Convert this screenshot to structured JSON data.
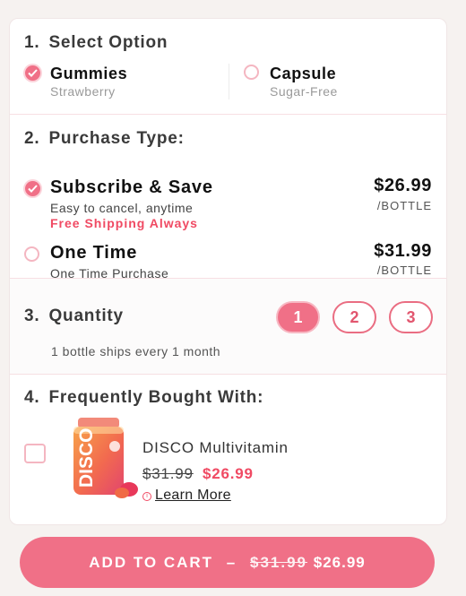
{
  "select_option": {
    "number": "1.",
    "title": "Select Option",
    "options": [
      {
        "label": "Gummies",
        "sub": "Strawberry",
        "selected": true
      },
      {
        "label": "Capsule",
        "sub": "Sugar-Free",
        "selected": false
      }
    ]
  },
  "purchase_type": {
    "number": "2.",
    "title": "Purchase Type:",
    "options": [
      {
        "label": "Subscribe & Save",
        "sub": "Easy to cancel, anytime",
        "highlight": "Free Shipping Always",
        "price": "$26.99",
        "per": "/BOTTLE",
        "selected": true
      },
      {
        "label": "One Time",
        "sub": "One Time Purchase",
        "price": "$31.99",
        "per": "/BOTTLE",
        "selected": false
      }
    ]
  },
  "quantity": {
    "number": "3.",
    "title": "Quantity",
    "options": [
      "1",
      "2",
      "3"
    ],
    "selected": "1",
    "note": "1 bottle ships every 1 month"
  },
  "frequently_bought": {
    "number": "4.",
    "title": "Frequently Bought With:",
    "product": {
      "name": "DISCO Multivitamin",
      "old_price": "$31.99",
      "new_price": "$26.99",
      "learn_more": "Learn More",
      "checked": false,
      "image_icon": "vitamin-bottle-image",
      "brand_text": "DISCO"
    }
  },
  "cta": {
    "label": "ADD TO CART",
    "separator": "–",
    "old_price": "$31.99",
    "new_price": "$26.99"
  },
  "colors": {
    "accent": "#f07087",
    "accent_text": "#f04a63",
    "background": "#f6f2f0"
  }
}
